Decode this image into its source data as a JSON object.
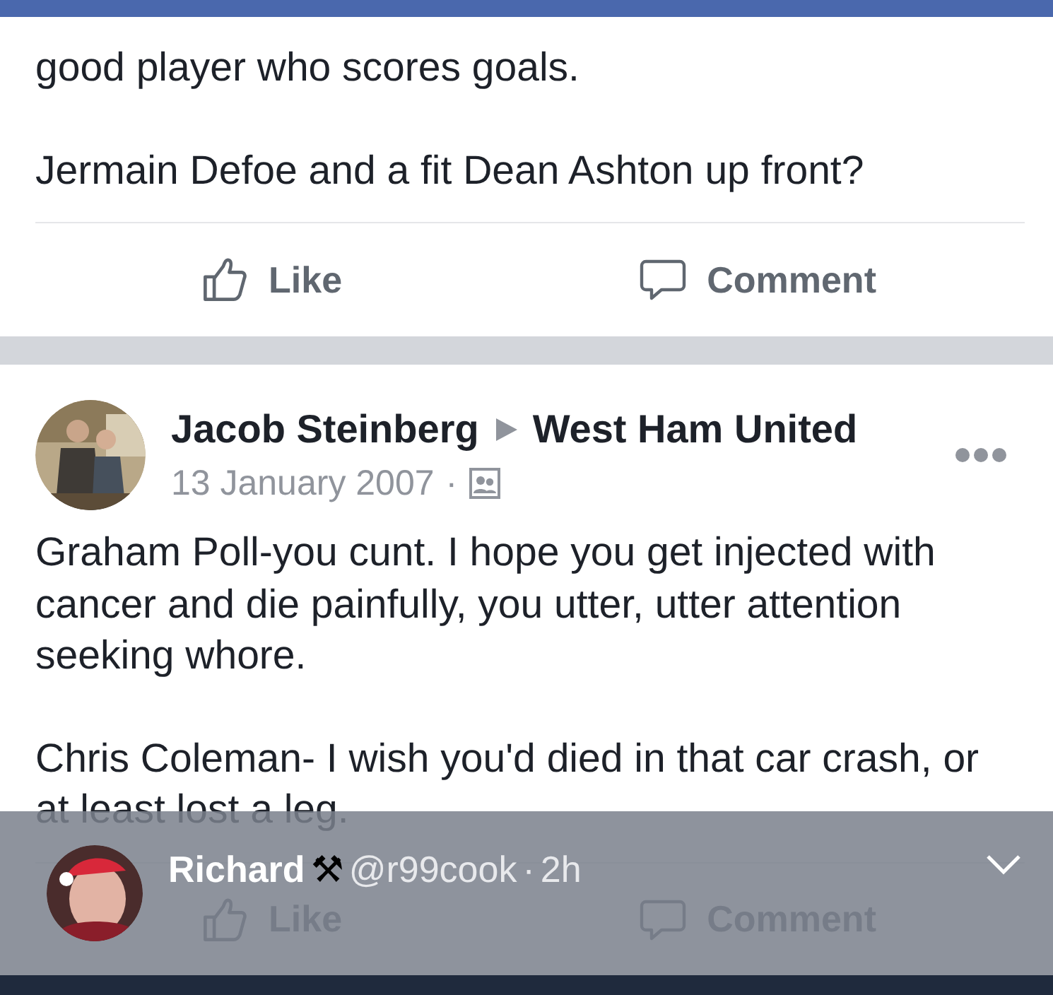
{
  "posts": [
    {
      "body": [
        "good player who scores goals.",
        "Jermain Defoe and a fit Dean Ashton up front?"
      ],
      "actions": [
        {
          "kind": "like",
          "label": "Like"
        },
        {
          "kind": "comment",
          "label": "Comment"
        }
      ]
    },
    {
      "author": "Jacob Steinberg",
      "target": "West Ham United",
      "date": "13 January 2007",
      "date_separator": "·",
      "body": [
        "Graham Poll-you cunt. I hope you get injected with cancer and die painfully, you utter, utter attention seeking whore.",
        "Chris Coleman- I wish you'd died in that car crash, or at least lost a leg."
      ],
      "actions": [
        {
          "kind": "like",
          "label": "Like"
        },
        {
          "kind": "comment",
          "label": "Comment"
        }
      ]
    }
  ],
  "notification": {
    "name": "Richard",
    "emoji": "⚒",
    "handle": "@r99cook",
    "separator": "·",
    "time": "2h"
  }
}
